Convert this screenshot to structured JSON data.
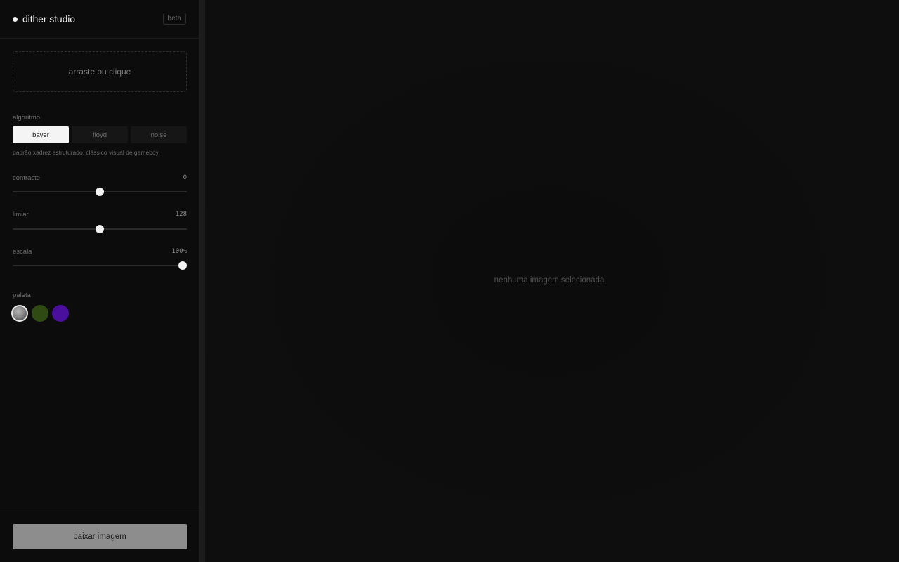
{
  "header": {
    "brand": "dither studio",
    "badge": "beta"
  },
  "upload": {
    "label": "arraste ou clique"
  },
  "algorithm": {
    "label": "algoritmo",
    "options": [
      "bayer",
      "floyd",
      "noise"
    ],
    "selected": "bayer",
    "description": "padrão xadrez estruturado, clássico visual de gameboy."
  },
  "sliders": {
    "contrast": {
      "label": "contraste",
      "value": "0",
      "fraction": 0.5
    },
    "threshold": {
      "label": "limiar",
      "value": "128",
      "fraction": 0.5
    },
    "scale": {
      "label": "escala",
      "value": "100%",
      "fraction": 0.975
    }
  },
  "palette": {
    "label": "paleta",
    "swatches": [
      {
        "name": "grayscale",
        "color": "#8a8a8a",
        "selected": true
      },
      {
        "name": "green",
        "color": "#2f4a12",
        "selected": false
      },
      {
        "name": "purple",
        "color": "#4b0f9e",
        "selected": false
      }
    ]
  },
  "footer": {
    "download_label": "baixar imagem"
  },
  "canvas": {
    "empty_label": "nenhuma imagem selecionada"
  },
  "colors": {
    "background": "#0a0a0a",
    "accent": "#f4f4f4",
    "button_disabled": "#8d8d8d"
  }
}
